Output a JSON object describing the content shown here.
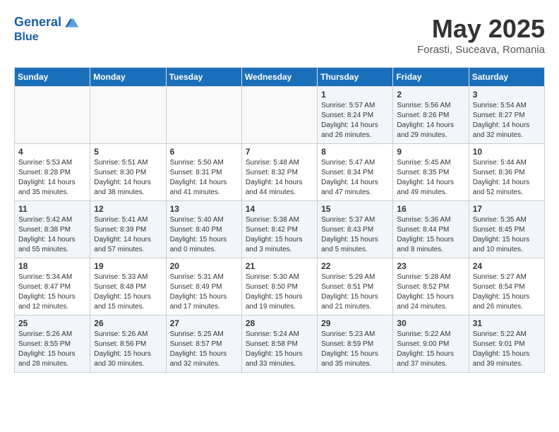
{
  "header": {
    "logo_line1": "General",
    "logo_line2": "Blue",
    "month": "May 2025",
    "location": "Forasti, Suceava, Romania"
  },
  "weekdays": [
    "Sunday",
    "Monday",
    "Tuesday",
    "Wednesday",
    "Thursday",
    "Friday",
    "Saturday"
  ],
  "weeks": [
    [
      {
        "day": "",
        "info": ""
      },
      {
        "day": "",
        "info": ""
      },
      {
        "day": "",
        "info": ""
      },
      {
        "day": "",
        "info": ""
      },
      {
        "day": "1",
        "info": "Sunrise: 5:57 AM\nSunset: 8:24 PM\nDaylight: 14 hours and 26 minutes."
      },
      {
        "day": "2",
        "info": "Sunrise: 5:56 AM\nSunset: 8:26 PM\nDaylight: 14 hours and 29 minutes."
      },
      {
        "day": "3",
        "info": "Sunrise: 5:54 AM\nSunset: 8:27 PM\nDaylight: 14 hours and 32 minutes."
      }
    ],
    [
      {
        "day": "4",
        "info": "Sunrise: 5:53 AM\nSunset: 8:28 PM\nDaylight: 14 hours and 35 minutes."
      },
      {
        "day": "5",
        "info": "Sunrise: 5:51 AM\nSunset: 8:30 PM\nDaylight: 14 hours and 38 minutes."
      },
      {
        "day": "6",
        "info": "Sunrise: 5:50 AM\nSunset: 8:31 PM\nDaylight: 14 hours and 41 minutes."
      },
      {
        "day": "7",
        "info": "Sunrise: 5:48 AM\nSunset: 8:32 PM\nDaylight: 14 hours and 44 minutes."
      },
      {
        "day": "8",
        "info": "Sunrise: 5:47 AM\nSunset: 8:34 PM\nDaylight: 14 hours and 47 minutes."
      },
      {
        "day": "9",
        "info": "Sunrise: 5:45 AM\nSunset: 8:35 PM\nDaylight: 14 hours and 49 minutes."
      },
      {
        "day": "10",
        "info": "Sunrise: 5:44 AM\nSunset: 8:36 PM\nDaylight: 14 hours and 52 minutes."
      }
    ],
    [
      {
        "day": "11",
        "info": "Sunrise: 5:42 AM\nSunset: 8:38 PM\nDaylight: 14 hours and 55 minutes."
      },
      {
        "day": "12",
        "info": "Sunrise: 5:41 AM\nSunset: 8:39 PM\nDaylight: 14 hours and 57 minutes."
      },
      {
        "day": "13",
        "info": "Sunrise: 5:40 AM\nSunset: 8:40 PM\nDaylight: 15 hours and 0 minutes."
      },
      {
        "day": "14",
        "info": "Sunrise: 5:38 AM\nSunset: 8:42 PM\nDaylight: 15 hours and 3 minutes."
      },
      {
        "day": "15",
        "info": "Sunrise: 5:37 AM\nSunset: 8:43 PM\nDaylight: 15 hours and 5 minutes."
      },
      {
        "day": "16",
        "info": "Sunrise: 5:36 AM\nSunset: 8:44 PM\nDaylight: 15 hours and 8 minutes."
      },
      {
        "day": "17",
        "info": "Sunrise: 5:35 AM\nSunset: 8:45 PM\nDaylight: 15 hours and 10 minutes."
      }
    ],
    [
      {
        "day": "18",
        "info": "Sunrise: 5:34 AM\nSunset: 8:47 PM\nDaylight: 15 hours and 12 minutes."
      },
      {
        "day": "19",
        "info": "Sunrise: 5:33 AM\nSunset: 8:48 PM\nDaylight: 15 hours and 15 minutes."
      },
      {
        "day": "20",
        "info": "Sunrise: 5:31 AM\nSunset: 8:49 PM\nDaylight: 15 hours and 17 minutes."
      },
      {
        "day": "21",
        "info": "Sunrise: 5:30 AM\nSunset: 8:50 PM\nDaylight: 15 hours and 19 minutes."
      },
      {
        "day": "22",
        "info": "Sunrise: 5:29 AM\nSunset: 8:51 PM\nDaylight: 15 hours and 21 minutes."
      },
      {
        "day": "23",
        "info": "Sunrise: 5:28 AM\nSunset: 8:52 PM\nDaylight: 15 hours and 24 minutes."
      },
      {
        "day": "24",
        "info": "Sunrise: 5:27 AM\nSunset: 8:54 PM\nDaylight: 15 hours and 26 minutes."
      }
    ],
    [
      {
        "day": "25",
        "info": "Sunrise: 5:26 AM\nSunset: 8:55 PM\nDaylight: 15 hours and 28 minutes."
      },
      {
        "day": "26",
        "info": "Sunrise: 5:26 AM\nSunset: 8:56 PM\nDaylight: 15 hours and 30 minutes."
      },
      {
        "day": "27",
        "info": "Sunrise: 5:25 AM\nSunset: 8:57 PM\nDaylight: 15 hours and 32 minutes."
      },
      {
        "day": "28",
        "info": "Sunrise: 5:24 AM\nSunset: 8:58 PM\nDaylight: 15 hours and 33 minutes."
      },
      {
        "day": "29",
        "info": "Sunrise: 5:23 AM\nSunset: 8:59 PM\nDaylight: 15 hours and 35 minutes."
      },
      {
        "day": "30",
        "info": "Sunrise: 5:22 AM\nSunset: 9:00 PM\nDaylight: 15 hours and 37 minutes."
      },
      {
        "day": "31",
        "info": "Sunrise: 5:22 AM\nSunset: 9:01 PM\nDaylight: 15 hours and 39 minutes."
      }
    ]
  ]
}
